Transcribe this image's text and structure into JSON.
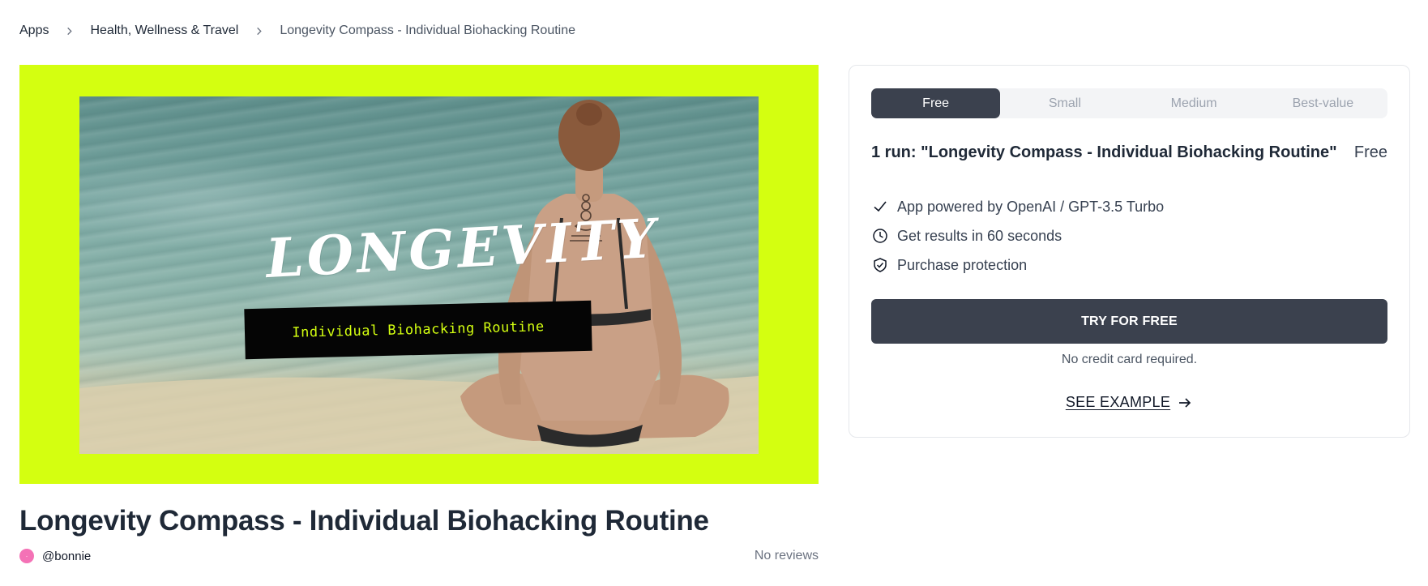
{
  "breadcrumb": {
    "items": [
      {
        "label": "Apps"
      },
      {
        "label": "Health, Wellness & Travel"
      },
      {
        "label": "Longevity Compass - Individual Biohacking Routine"
      }
    ]
  },
  "hero": {
    "title": "LONGEVITY",
    "subtitle": "Individual Biohacking Routine",
    "background_color": "#d4ff10"
  },
  "app": {
    "title": "Longevity Compass - Individual Biohacking Routine",
    "author": "@bonnie",
    "reviews": "No reviews"
  },
  "pricing": {
    "tiers": [
      {
        "label": "Free",
        "active": true
      },
      {
        "label": "Small",
        "active": false
      },
      {
        "label": "Medium",
        "active": false
      },
      {
        "label": "Best-value",
        "active": false
      }
    ],
    "run_title": "1 run: \"Longevity Compass - Individual Biohacking Routine\"",
    "run_price": "Free",
    "features": [
      {
        "icon": "check-icon",
        "label": "App powered by OpenAI / GPT-3.5 Turbo"
      },
      {
        "icon": "clock-icon",
        "label": "Get results in 60 seconds"
      },
      {
        "icon": "shield-check-icon",
        "label": "Purchase protection"
      }
    ],
    "cta_label": "TRY FOR FREE",
    "note": "No credit card required.",
    "example_label": "SEE EXAMPLE"
  },
  "colors": {
    "accent_dark": "#3b414e",
    "lime": "#d4ff10",
    "avatar": "#f472b6"
  }
}
